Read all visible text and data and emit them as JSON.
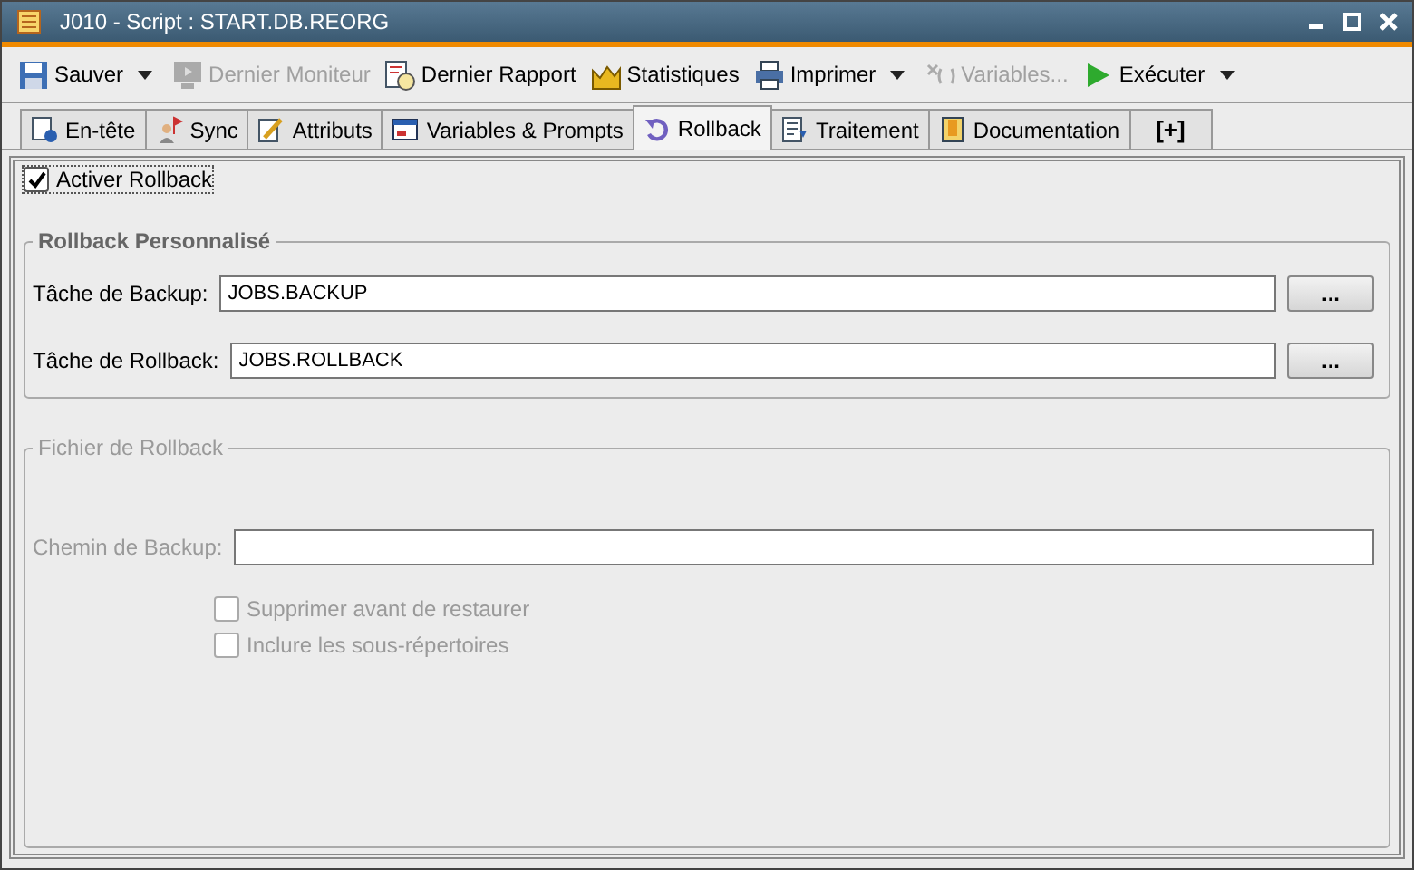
{
  "window": {
    "title": "J010 - Script : START.DB.REORG"
  },
  "toolbar": [
    {
      "label": "Sauver",
      "disabled": false,
      "dropdown": true
    },
    {
      "label": "Dernier Moniteur",
      "disabled": true,
      "dropdown": false
    },
    {
      "label": "Dernier Rapport",
      "disabled": false,
      "dropdown": false
    },
    {
      "label": "Statistiques",
      "disabled": false,
      "dropdown": false
    },
    {
      "label": "Imprimer",
      "disabled": false,
      "dropdown": true
    },
    {
      "label": "Variables...",
      "disabled": true,
      "dropdown": false
    },
    {
      "label": "Exécuter",
      "disabled": false,
      "dropdown": true
    }
  ],
  "tabs": [
    {
      "label": "En-tête",
      "selected": false
    },
    {
      "label": "Sync",
      "selected": false
    },
    {
      "label": "Attributs",
      "selected": false
    },
    {
      "label": "Variables & Prompts",
      "selected": false
    },
    {
      "label": "Rollback",
      "selected": true
    },
    {
      "label": "Traitement",
      "selected": false
    },
    {
      "label": "Documentation",
      "selected": false
    },
    {
      "label": "[+]",
      "selected": false
    }
  ],
  "enable": {
    "label": "Activer Rollback",
    "checked": true
  },
  "groups": [
    {
      "title": "Rollback Personnalisé",
      "disabled": false,
      "fields": [
        {
          "label": "Tâche de Backup:",
          "value": "JOBS.BACKUP",
          "button": "..."
        },
        {
          "label": "Tâche de Rollback:",
          "value": "JOBS.ROLLBACK",
          "button": "..."
        }
      ]
    },
    {
      "title": "Fichier de Rollback",
      "disabled": true,
      "fields": [
        {
          "label": "Chemin de Backup:"
        }
      ],
      "options": [
        {
          "label": "Supprimer avant de restaurer",
          "checked": false
        },
        {
          "label": "Inclure les sous-répertoires",
          "checked": false
        }
      ]
    }
  ]
}
